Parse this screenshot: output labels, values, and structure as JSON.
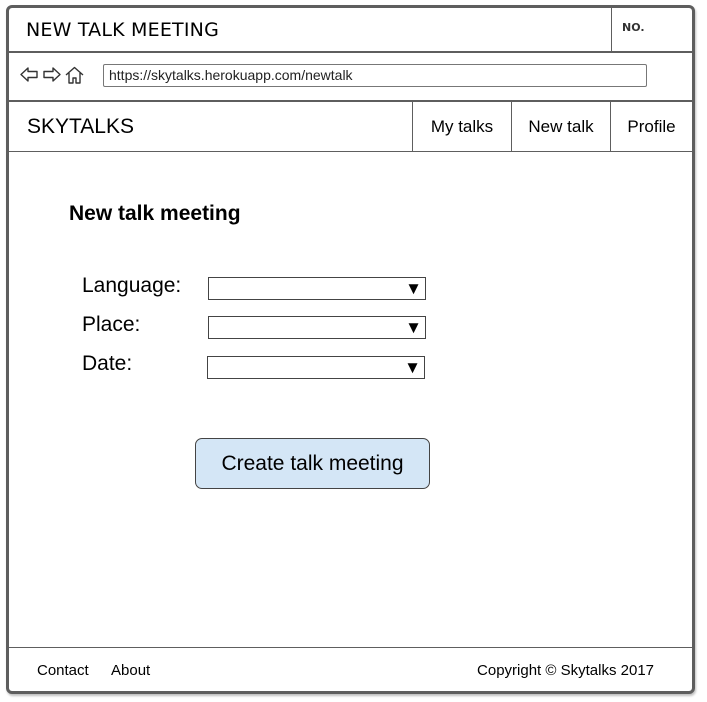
{
  "window": {
    "title": "NEW TALK MEETING",
    "number_label": "NO."
  },
  "browser": {
    "url": "https://skytalks.herokuapp.com/newtalk",
    "icons": [
      "back-arrow-icon",
      "forward-arrow-icon",
      "home-icon"
    ]
  },
  "app_nav": {
    "brand": "SKYTALKS",
    "tabs": [
      {
        "label": "My talks"
      },
      {
        "label": "New talk"
      },
      {
        "label": "Profile"
      }
    ]
  },
  "form": {
    "title": "New talk meeting",
    "fields": [
      {
        "label": "Language:",
        "value": ""
      },
      {
        "label": "Place:",
        "value": ""
      },
      {
        "label": "Date:",
        "value": ""
      }
    ],
    "dropdown_arrow": "▼",
    "submit_label": "Create talk meeting"
  },
  "colors": {
    "button_fill": "#d4e6f6",
    "border": "#5e5e5e"
  },
  "footer": {
    "links": [
      {
        "label": "Contact"
      },
      {
        "label": "About"
      }
    ],
    "copyright": "Copyright © Skytalks 2017"
  }
}
